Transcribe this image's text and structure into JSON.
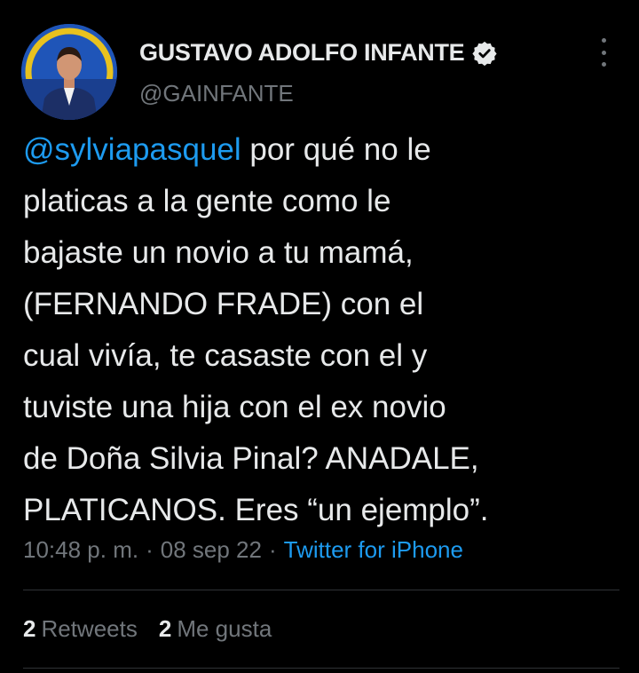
{
  "user": {
    "display_name": "GUSTAVO ADOLFO INFANTE",
    "handle": "@GAINFANTE",
    "verified": true
  },
  "tweet": {
    "mention": "@sylviapasquel",
    "lines": [
      " por qué no le",
      "platicas a la gente como le",
      "bajaste un novio a tu mamá,",
      "(FERNANDO FRADE) con el",
      "cual vivía, te casaste con el y",
      "tuviste una hija con el ex novio",
      "de Doña Silvia Pinal? ANADALE,",
      "PLATICANOS. Eres “un ejemplo”."
    ]
  },
  "meta": {
    "time": "10:48 p. m.",
    "separator": "·",
    "date": "08 sep 22",
    "source": "Twitter for iPhone"
  },
  "stats": {
    "retweets_count": "2",
    "retweets_label": "Retweets",
    "likes_count": "2",
    "likes_label": "Me gusta"
  },
  "icons": {
    "verified": "verified-badge-icon",
    "more": "more-options-icon",
    "avatar": "profile-avatar"
  },
  "colors": {
    "background": "#000000",
    "text": "#e7e9ea",
    "secondary": "#71767b",
    "link": "#1d9bf0",
    "divider": "#2f3336"
  }
}
